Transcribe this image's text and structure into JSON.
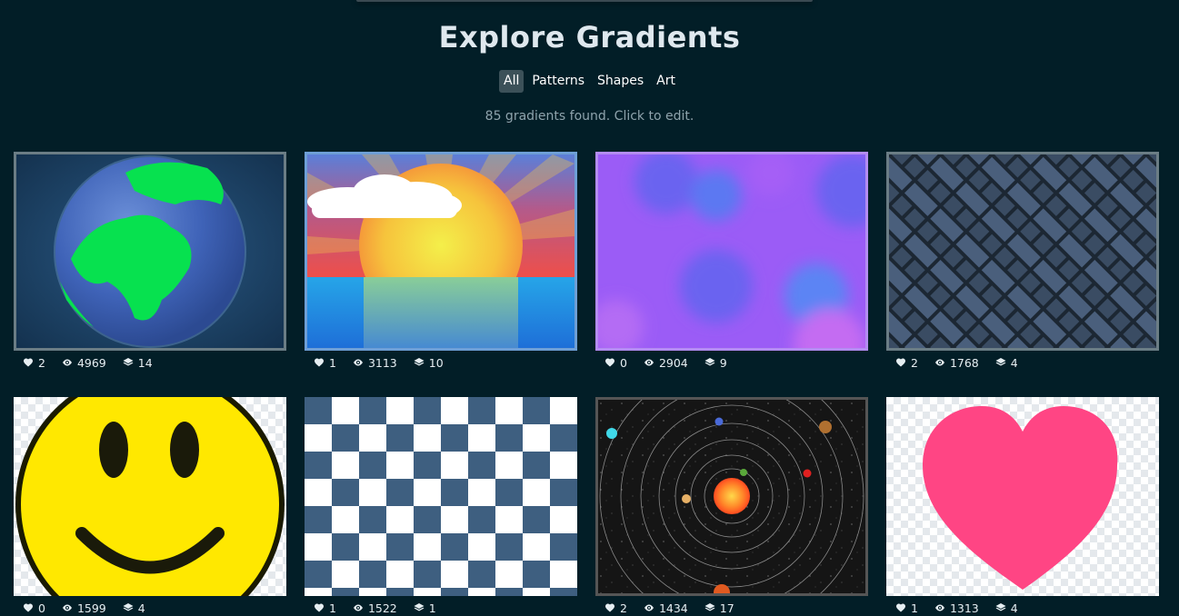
{
  "page": {
    "title": "Explore Gradients",
    "count_text": "85 gradients found. Click to edit."
  },
  "filters": [
    {
      "label": "All",
      "active": true
    },
    {
      "label": "Patterns",
      "active": false
    },
    {
      "label": "Shapes",
      "active": false
    },
    {
      "label": "Art",
      "active": false
    }
  ],
  "icons": {
    "likes": "heart-icon",
    "views": "eye-icon",
    "layers": "layers-icon"
  },
  "cards": [
    {
      "name": "earth",
      "likes": "2",
      "views": "4969",
      "layers": "14",
      "border": "#6b7d85"
    },
    {
      "name": "sunset",
      "likes": "1",
      "views": "3113",
      "layers": "10",
      "border": "#6e9fd6"
    },
    {
      "name": "bokeh",
      "likes": "0",
      "views": "2904",
      "layers": "9",
      "border": "#b48cf2"
    },
    {
      "name": "weave",
      "likes": "2",
      "views": "1768",
      "layers": "4",
      "border": "#6b7d85"
    },
    {
      "name": "smiley",
      "likes": "0",
      "views": "1599",
      "layers": "4",
      "border": "none"
    },
    {
      "name": "checkerboard",
      "likes": "1",
      "views": "1522",
      "layers": "1",
      "border": "none"
    },
    {
      "name": "solar-system",
      "likes": "2",
      "views": "1434",
      "layers": "17",
      "border": "#555555"
    },
    {
      "name": "heart",
      "likes": "1",
      "views": "1313",
      "layers": "4",
      "border": "none"
    }
  ]
}
